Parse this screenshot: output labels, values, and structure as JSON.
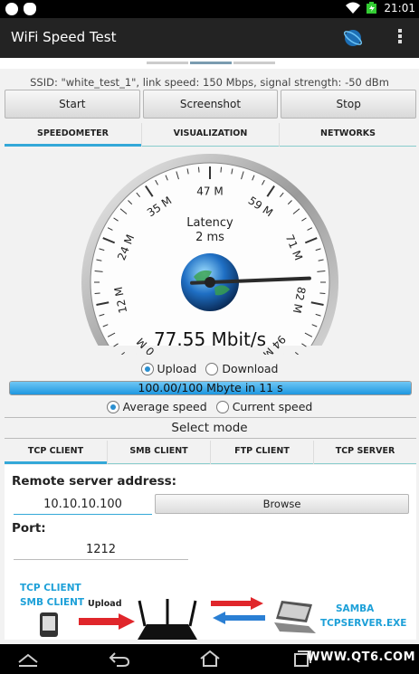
{
  "status_bar": {
    "time": "21:01",
    "left_icons": [
      "messenger-icon",
      "cat-icon"
    ],
    "right_icons": [
      "wifi-icon",
      "battery-charging-icon"
    ]
  },
  "action_bar": {
    "title": "WiFi Speed Test",
    "icons": [
      "globe-icon",
      "overflow-menu-icon"
    ]
  },
  "ssid_line": "SSID: \"white_test_1\", link speed: 150 Mbps, signal strength: -50 dBm",
  "buttons": {
    "start": "Start",
    "screenshot": "Screenshot",
    "stop": "Stop"
  },
  "main_tabs": [
    {
      "label": "SPEEDOMETER",
      "active": true
    },
    {
      "label": "VISUALIZATION",
      "active": false
    },
    {
      "label": "NETWORKS",
      "active": false
    }
  ],
  "gauge": {
    "latency_label": "Latency",
    "latency_value": "2 ms",
    "speed_readout": "77.55 Mbit/s",
    "scale_labels": [
      "0 M",
      "12 M",
      "24 M",
      "35 M",
      "47 M",
      "59 M",
      "71 M",
      "82 M",
      "94 M"
    ],
    "scale_max": 94,
    "needle_value": 77.55
  },
  "direction_radios": {
    "upload": "Upload",
    "download": "Download",
    "selected": "upload"
  },
  "progress": {
    "text": "100.00/100 Mbyte in 11 s",
    "fraction": 1.0
  },
  "speed_radios": {
    "average": "Average speed",
    "current": "Current speed",
    "selected": "average"
  },
  "select_mode": "Select mode",
  "mode_tabs": [
    {
      "label": "TCP CLIENT",
      "active": true
    },
    {
      "label": "SMB CLIENT",
      "active": false
    },
    {
      "label": "FTP CLIENT",
      "active": false
    },
    {
      "label": "TCP SERVER",
      "active": false
    }
  ],
  "client_panel": {
    "remote_label": "Remote server address:",
    "remote_value": "10.10.10.100",
    "browse_label": "Browse",
    "port_label": "Port:",
    "port_value": "1212"
  },
  "diagram": {
    "client_labels": [
      "TCP CLIENT",
      "SMB CLIENT"
    ],
    "upload_label": "Upload",
    "server_labels": [
      "SAMBA",
      "TCPSERVER.EXE"
    ]
  },
  "watermark": "WWW.QT6.COM",
  "colors": {
    "accent": "#33a8d8",
    "action_bar": "#232323",
    "progress": "#1e97e0",
    "arrow_red": "#e0262b",
    "arrow_blue": "#2a7fd4"
  }
}
